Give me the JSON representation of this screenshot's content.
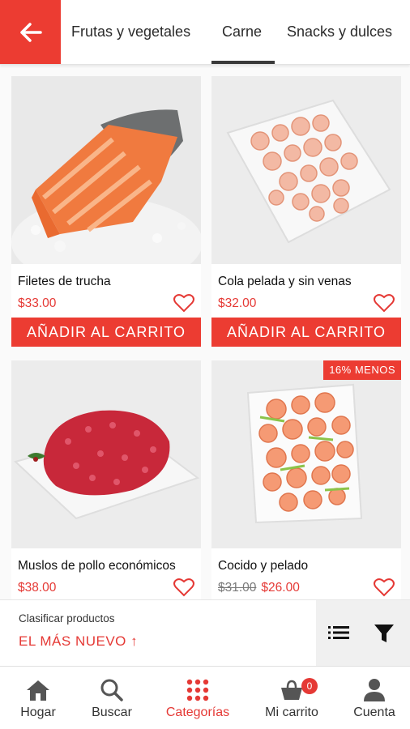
{
  "header": {
    "back_icon": "arrow-left-icon",
    "tabs": [
      {
        "label": "Frutas y vegetales",
        "active": false
      },
      {
        "label": "Carne",
        "active": true
      },
      {
        "label": "Snacks y dulces",
        "active": false
      }
    ]
  },
  "products": [
    {
      "name": "Filetes de trucha",
      "price": "$33.00",
      "button": "AÑADIR AL CARRITO",
      "image": "trout-fillet"
    },
    {
      "name": "Cola pelada y sin venas",
      "price": "$32.00",
      "button": "AÑADIR AL CARRITO",
      "image": "peeled-shrimp"
    },
    {
      "name": "Muslos de pollo económicos",
      "price": "$38.00",
      "image": "ground-meat"
    },
    {
      "name": "Cocido y pelado",
      "old_price": "$31.00",
      "price": "$26.00",
      "badge": "16% MENOS",
      "image": "cooked-shrimp"
    }
  ],
  "sort": {
    "label": "Clasificar productos",
    "value": "EL MÁS NUEVO ↑",
    "list_icon": "list-view-icon",
    "filter_icon": "filter-icon"
  },
  "nav": {
    "items": [
      {
        "label": "Hogar",
        "icon": "home-icon",
        "active": false
      },
      {
        "label": "Buscar",
        "icon": "search-icon",
        "active": false
      },
      {
        "label": "Categorías",
        "icon": "grid-dots-icon",
        "active": true
      },
      {
        "label": "Mi carrito",
        "icon": "cart-icon",
        "active": false,
        "badge": "0"
      },
      {
        "label": "Cuenta",
        "icon": "user-icon",
        "active": false
      }
    ]
  },
  "colors": {
    "accent": "#ec3c32",
    "price": "#e53935",
    "tab_underline": "#3a3a3a"
  }
}
